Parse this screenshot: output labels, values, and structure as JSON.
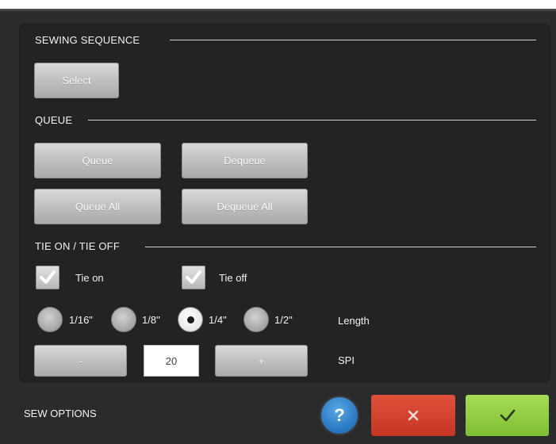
{
  "sections": {
    "sewing_sequence": "SEWING SEQUENCE",
    "queue": "QUEUE",
    "tie": "TIE ON / TIE OFF"
  },
  "buttons": {
    "select": "Select",
    "queue": "Queue",
    "dequeue": "Dequeue",
    "queue_all": "Queue All",
    "dequeue_all": "Dequeue All",
    "minus": "-",
    "plus": "+"
  },
  "checkboxes": [
    {
      "label": "Tie on",
      "checked": true
    },
    {
      "label": "Tie off",
      "checked": true
    }
  ],
  "length": {
    "label": "Length",
    "options": [
      "1/16\"",
      "1/8\"",
      "1/4\"",
      "1/2\""
    ],
    "selected": "1/4\""
  },
  "spi": {
    "label": "SPI",
    "value": "20"
  },
  "footer": {
    "label": "SEW OPTIONS",
    "help": "?"
  },
  "icons": {
    "check": "checkmark-icon",
    "cancel": "x-icon",
    "ok": "checkmark-icon",
    "help": "question-icon"
  },
  "colors": {
    "help": "#2a78c2",
    "cancel": "#d23f2c",
    "ok": "#8ccb3c"
  }
}
